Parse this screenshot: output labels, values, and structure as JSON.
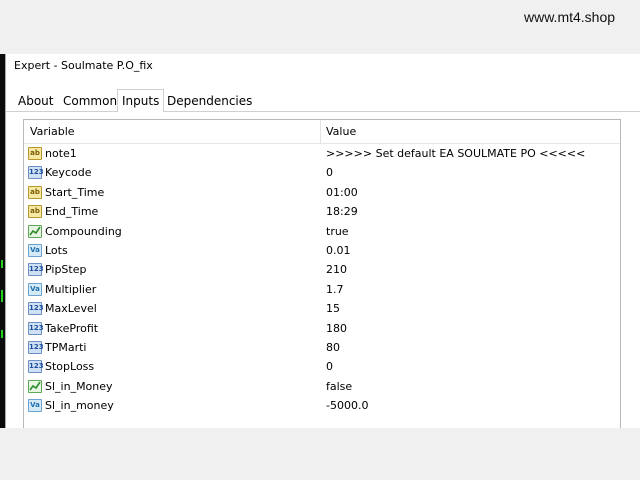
{
  "window": {
    "title": "Expert - Soulmate P.O_fix",
    "watermark": "www.mt4.shop"
  },
  "tabs": [
    {
      "label": "About",
      "active": false
    },
    {
      "label": "Common",
      "active": false
    },
    {
      "label": "Inputs",
      "active": true
    },
    {
      "label": "Dependencies",
      "active": false
    }
  ],
  "table": {
    "columns": [
      "Variable",
      "Value"
    ],
    "rows": [
      {
        "icon": "ab",
        "icon_name": "string-type-icon",
        "name": "note1",
        "value": ">>>>> Set default EA SOULMATE PO <<<<<"
      },
      {
        "icon": "123",
        "icon_name": "integer-type-icon",
        "name": "Keycode",
        "value": "0"
      },
      {
        "icon": "ab",
        "icon_name": "string-type-icon",
        "name": "Start_Time",
        "value": "01:00"
      },
      {
        "icon": "ab",
        "icon_name": "string-type-icon",
        "name": "End_Time",
        "value": "18:29"
      },
      {
        "icon": "bool",
        "icon_name": "boolean-type-icon",
        "name": "Compounding",
        "value": "true"
      },
      {
        "icon": "va",
        "icon_name": "double-type-icon",
        "name": "Lots",
        "value": "0.01"
      },
      {
        "icon": "123",
        "icon_name": "integer-type-icon",
        "name": "PipStep",
        "value": "210"
      },
      {
        "icon": "va",
        "icon_name": "double-type-icon",
        "name": "Multiplier",
        "value": "1.7"
      },
      {
        "icon": "123",
        "icon_name": "integer-type-icon",
        "name": "MaxLevel",
        "value": "15"
      },
      {
        "icon": "123",
        "icon_name": "integer-type-icon",
        "name": "TakeProfit",
        "value": "180"
      },
      {
        "icon": "123",
        "icon_name": "integer-type-icon",
        "name": "TPMarti",
        "value": "80"
      },
      {
        "icon": "123",
        "icon_name": "integer-type-icon",
        "name": "StopLoss",
        "value": "0"
      },
      {
        "icon": "bool",
        "icon_name": "boolean-type-icon",
        "name": "Sl_in_Money",
        "value": "false"
      },
      {
        "icon": "va",
        "icon_name": "double-type-icon",
        "name": "Sl_in_money",
        "value": "-5000.0"
      }
    ]
  },
  "colors": {
    "string_icon": "#f6e9a6",
    "integer_icon": "#cfe0f5",
    "double_icon": "#d5eaf7",
    "boolean_icon": "#e7f6e1",
    "chart_strip": "#0b0b0b",
    "chart_line": "#22d022"
  }
}
